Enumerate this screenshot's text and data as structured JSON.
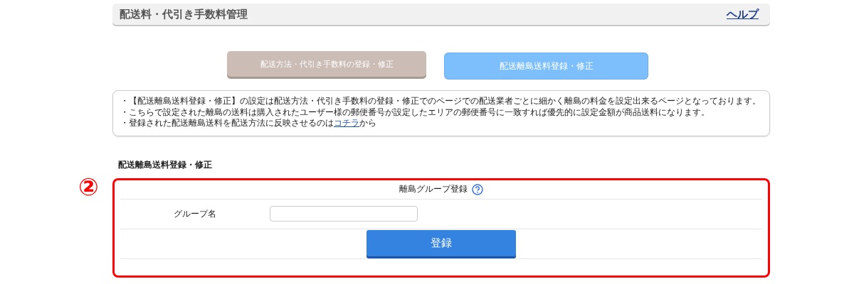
{
  "header": {
    "title": "配送料・代引き手数料管理",
    "help_link": "ヘルプ"
  },
  "tabs": [
    {
      "label": "配送方法・代引き手数料の登録・修正",
      "selected": false
    },
    {
      "label": "配送離島送料登録・修正",
      "selected": true
    }
  ],
  "notice": {
    "lines": [
      "・【配送離島送料登録・修正】の設定は配送方法・代引き手数料の登録・修正でのページでの配送業者ごとに細かく離島の料金を設定出来るページとなっております。",
      "・こちらで設定された離島の送料は購入されたユーザー様の郵便番号が設定したエリアの郵便番号に一致すれば優先的に設定金額が商品送料になります。"
    ],
    "last_line": {
      "before": "・登録された配送離島送料を配送方法に反映させるのは",
      "link": "コチラ",
      "after": "から"
    }
  },
  "section_title": "配送離島送料登録・修正",
  "callout_marker": "②",
  "form": {
    "heading": "離島グループ登録",
    "fields": [
      {
        "label": "グループ名"
      }
    ],
    "submit": "登録"
  }
}
